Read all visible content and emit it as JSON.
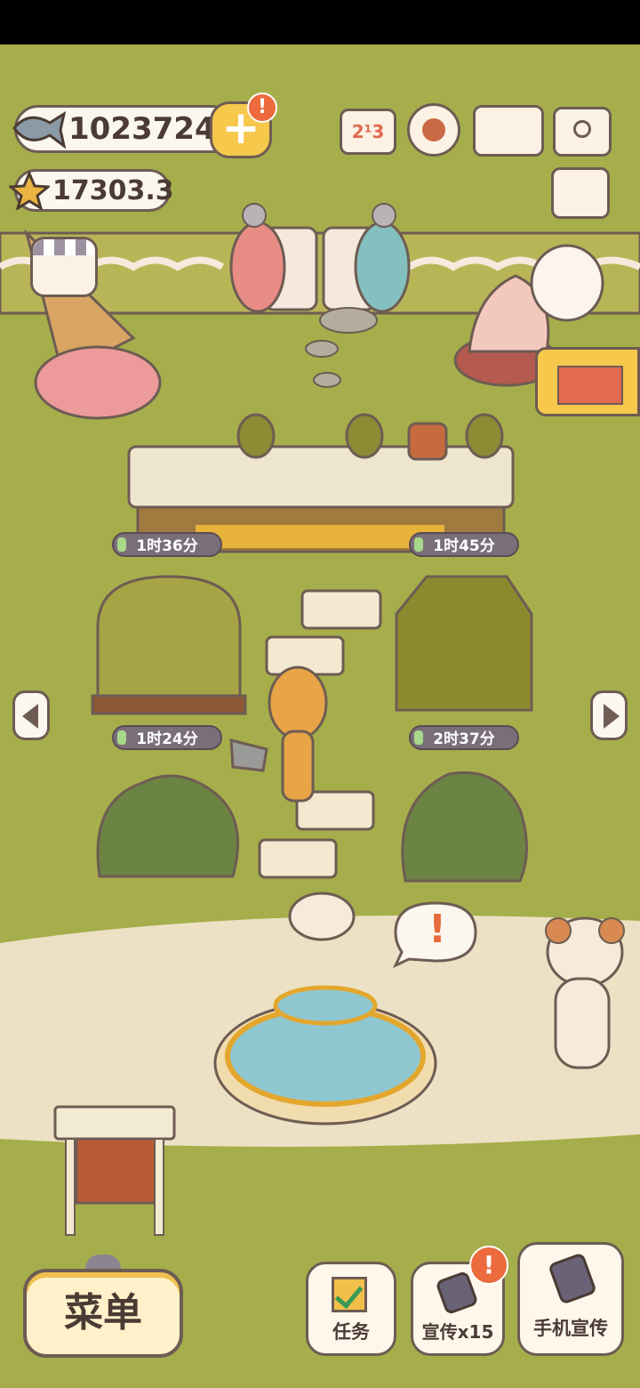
{
  "currency": {
    "fish": "1023724",
    "stars": "17303.3"
  },
  "alerts": {
    "plus_alert": "!",
    "promo_alert": "!",
    "cat_alert": "!"
  },
  "timers": [
    "1时36分",
    "1时45分",
    "1时24分",
    "2时37分"
  ],
  "buttons": {
    "menu": "菜单",
    "tasks": "任务",
    "promote": "宣传x15",
    "phone_promote": "手机宣传"
  },
  "icons": [
    "fish-icon",
    "star-icon",
    "plus-icon",
    "ranking-icon",
    "settings-gear-icon",
    "catalog-book-icon",
    "camera-icon",
    "newspaper-icon",
    "shop-icon",
    "building-blocks-icon",
    "arrow-left-icon",
    "arrow-right-icon",
    "task-checkbox-icon",
    "phone-icon"
  ],
  "colors": {
    "grass": "#a6ae4b",
    "path": "#ece1c4",
    "accent_yellow": "#f6c84b",
    "alert_red": "#ec6a3d",
    "outline": "#6e5c53"
  }
}
